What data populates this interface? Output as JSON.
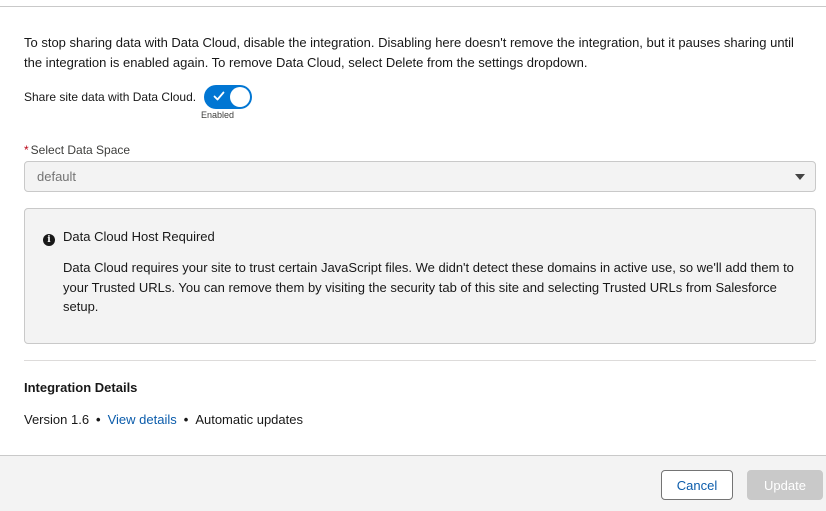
{
  "intro": {
    "text": "To stop sharing data with Data Cloud, disable the integration. Disabling here doesn't remove the integration, but it pauses sharing until the integration is enabled again. To remove Data Cloud, select Delete from the settings dropdown."
  },
  "share": {
    "label": "Share site data with Data Cloud.",
    "toggle_state": "Enabled",
    "enabled": true,
    "accent_color": "#0176d3"
  },
  "data_space": {
    "required_marker": "*",
    "label": "Select Data Space",
    "selected_value": "default",
    "caret_icon": "chevron-down-icon"
  },
  "notice": {
    "icon": "info-icon",
    "title": "Data Cloud Host Required",
    "body": "Data Cloud requires your site to trust certain JavaScript files. We didn't detect these domains in active use, so we'll add them to your Trusted URLs. You can remove them by visiting the security tab of this site and selecting Trusted URLs from Salesforce setup."
  },
  "details": {
    "heading": "Integration Details",
    "version": "Version 1.6",
    "separator": "•",
    "link": "View details",
    "updates": "Automatic updates"
  },
  "footer": {
    "cancel_label": "Cancel",
    "update_label": "Update"
  }
}
